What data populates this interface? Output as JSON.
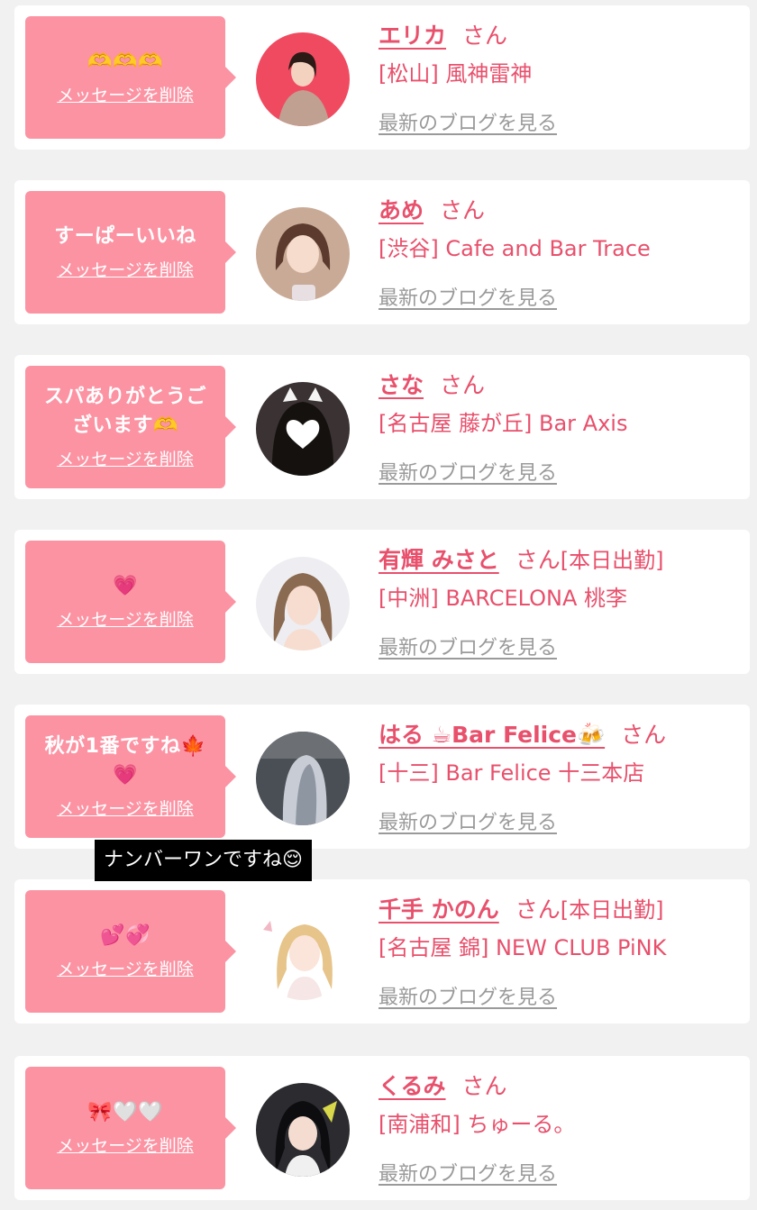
{
  "delete_label": "メッセージを削除",
  "blog_link_label": "最新のブログを見る",
  "honorific": "さん",
  "tooltip": "ナンバーワンですね😌",
  "colors": {
    "page_bg": "#f1f1f1",
    "bubble": "#fc93a3",
    "accent": "#e8506c",
    "link_gray": "#9a9a9a"
  },
  "items": [
    {
      "message": "🫶🫶🫶",
      "name": "エリカ",
      "status": "",
      "shop": "[松山] 風神雷神",
      "avatar_bg": "#f04a60",
      "avatar_fg": "#c0a090"
    },
    {
      "message": "すーぱーいいね",
      "name": "あめ",
      "status": "",
      "shop": "[渋谷] Cafe and Bar Trace",
      "avatar_bg": "#c9aa96",
      "avatar_fg": "#5c3b2e"
    },
    {
      "message": "スパありがとうございます🫶",
      "name": "さな",
      "status": "",
      "shop": "[名古屋 藤が丘] Bar Axis",
      "avatar_bg": "#3a3233",
      "avatar_fg": "#ffffff"
    },
    {
      "message": "💗",
      "name": "有輝 みさと",
      "status": "[本日出勤]",
      "shop": "[中洲] BARCELONA 桃李",
      "avatar_bg": "#eeeef2",
      "avatar_fg": "#8a6a50"
    },
    {
      "message": "秋が1番ですね🍁💗",
      "name": "はる ☕Bar Felice🍻",
      "status": "",
      "shop": "[十三] Bar Felice 十三本店",
      "avatar_bg": "#4a4f55",
      "avatar_fg": "#c8ccd4"
    },
    {
      "message": "💕💞",
      "name": "千手 かのん",
      "status": "[本日出勤]",
      "shop": "[名古屋 錦] NEW CLUB PiNK",
      "avatar_bg": "#ffffff",
      "avatar_fg": "#e6c48a"
    },
    {
      "message": "🎀🤍🤍",
      "name": "くるみ",
      "status": "",
      "shop": "[南浦和] ちゅーる。",
      "avatar_bg": "#2c2c30",
      "avatar_fg": "#f0f0f0"
    }
  ]
}
